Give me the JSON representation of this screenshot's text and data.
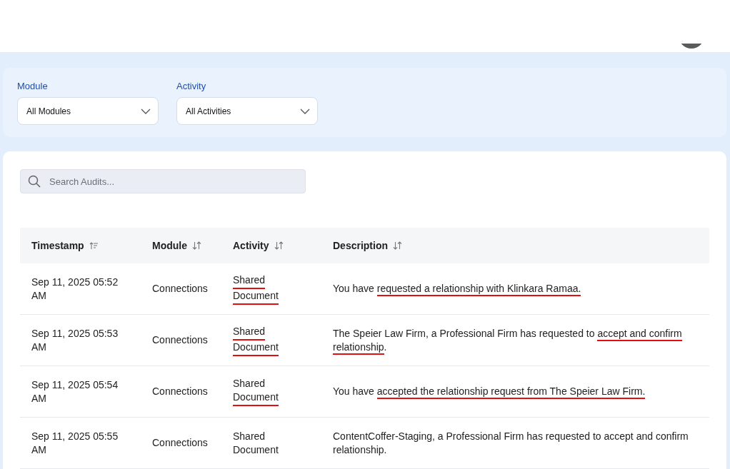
{
  "filters": [
    {
      "label": "Module",
      "value": "All Modules"
    },
    {
      "label": "Activity",
      "value": "All Activities"
    }
  ],
  "search": {
    "placeholder": "Search Audits..."
  },
  "table": {
    "columns": [
      {
        "label": "Timestamp",
        "sorted": true
      },
      {
        "label": "Module",
        "sorted": false
      },
      {
        "label": "Activity",
        "sorted": false
      },
      {
        "label": "Description",
        "sorted": false
      }
    ],
    "rows": [
      {
        "timestamp": "Sep 11, 2025 05:52 AM",
        "module": "Connections",
        "activity": [
          {
            "text": "Shared",
            "marked": true
          },
          {
            "text": "Document",
            "marked": true
          }
        ],
        "description": [
          {
            "text": "You have ",
            "marked": false
          },
          {
            "text": "requested a relationship with Klinkara Ramaa.",
            "marked": true
          }
        ]
      },
      {
        "timestamp": "Sep 11, 2025 05:53 AM",
        "module": "Connections",
        "activity": [
          {
            "text": "Shared",
            "marked": true
          },
          {
            "text": "Document",
            "marked": true
          }
        ],
        "description": [
          {
            "text": "The Speier Law Firm, a Professional Firm has requested to ",
            "marked": false
          },
          {
            "text": "accept and confirm ",
            "marked": true
          },
          {
            "text": "relationship",
            "marked": true
          },
          {
            "text": ".",
            "marked": false
          }
        ]
      },
      {
        "timestamp": "Sep 11, 2025 05:54 AM",
        "module": "Connections",
        "activity": [
          {
            "text": "Shared",
            "marked": false
          },
          {
            "text": "Document",
            "marked": true
          }
        ],
        "description": [
          {
            "text": "You have ",
            "marked": false
          },
          {
            "text": "accepted the relationship request from The Speier Law Firm.",
            "marked": true
          }
        ]
      },
      {
        "timestamp": "Sep 11, 2025 05:55 AM",
        "module": "Connections",
        "activity": [
          {
            "text": "Shared",
            "marked": false
          },
          {
            "text": "Document",
            "marked": false
          }
        ],
        "description": [
          {
            "text": "ContentCoffer-Staging, a Professional Firm has requested to accept and confirm relationship.",
            "marked": false
          }
        ]
      }
    ]
  }
}
